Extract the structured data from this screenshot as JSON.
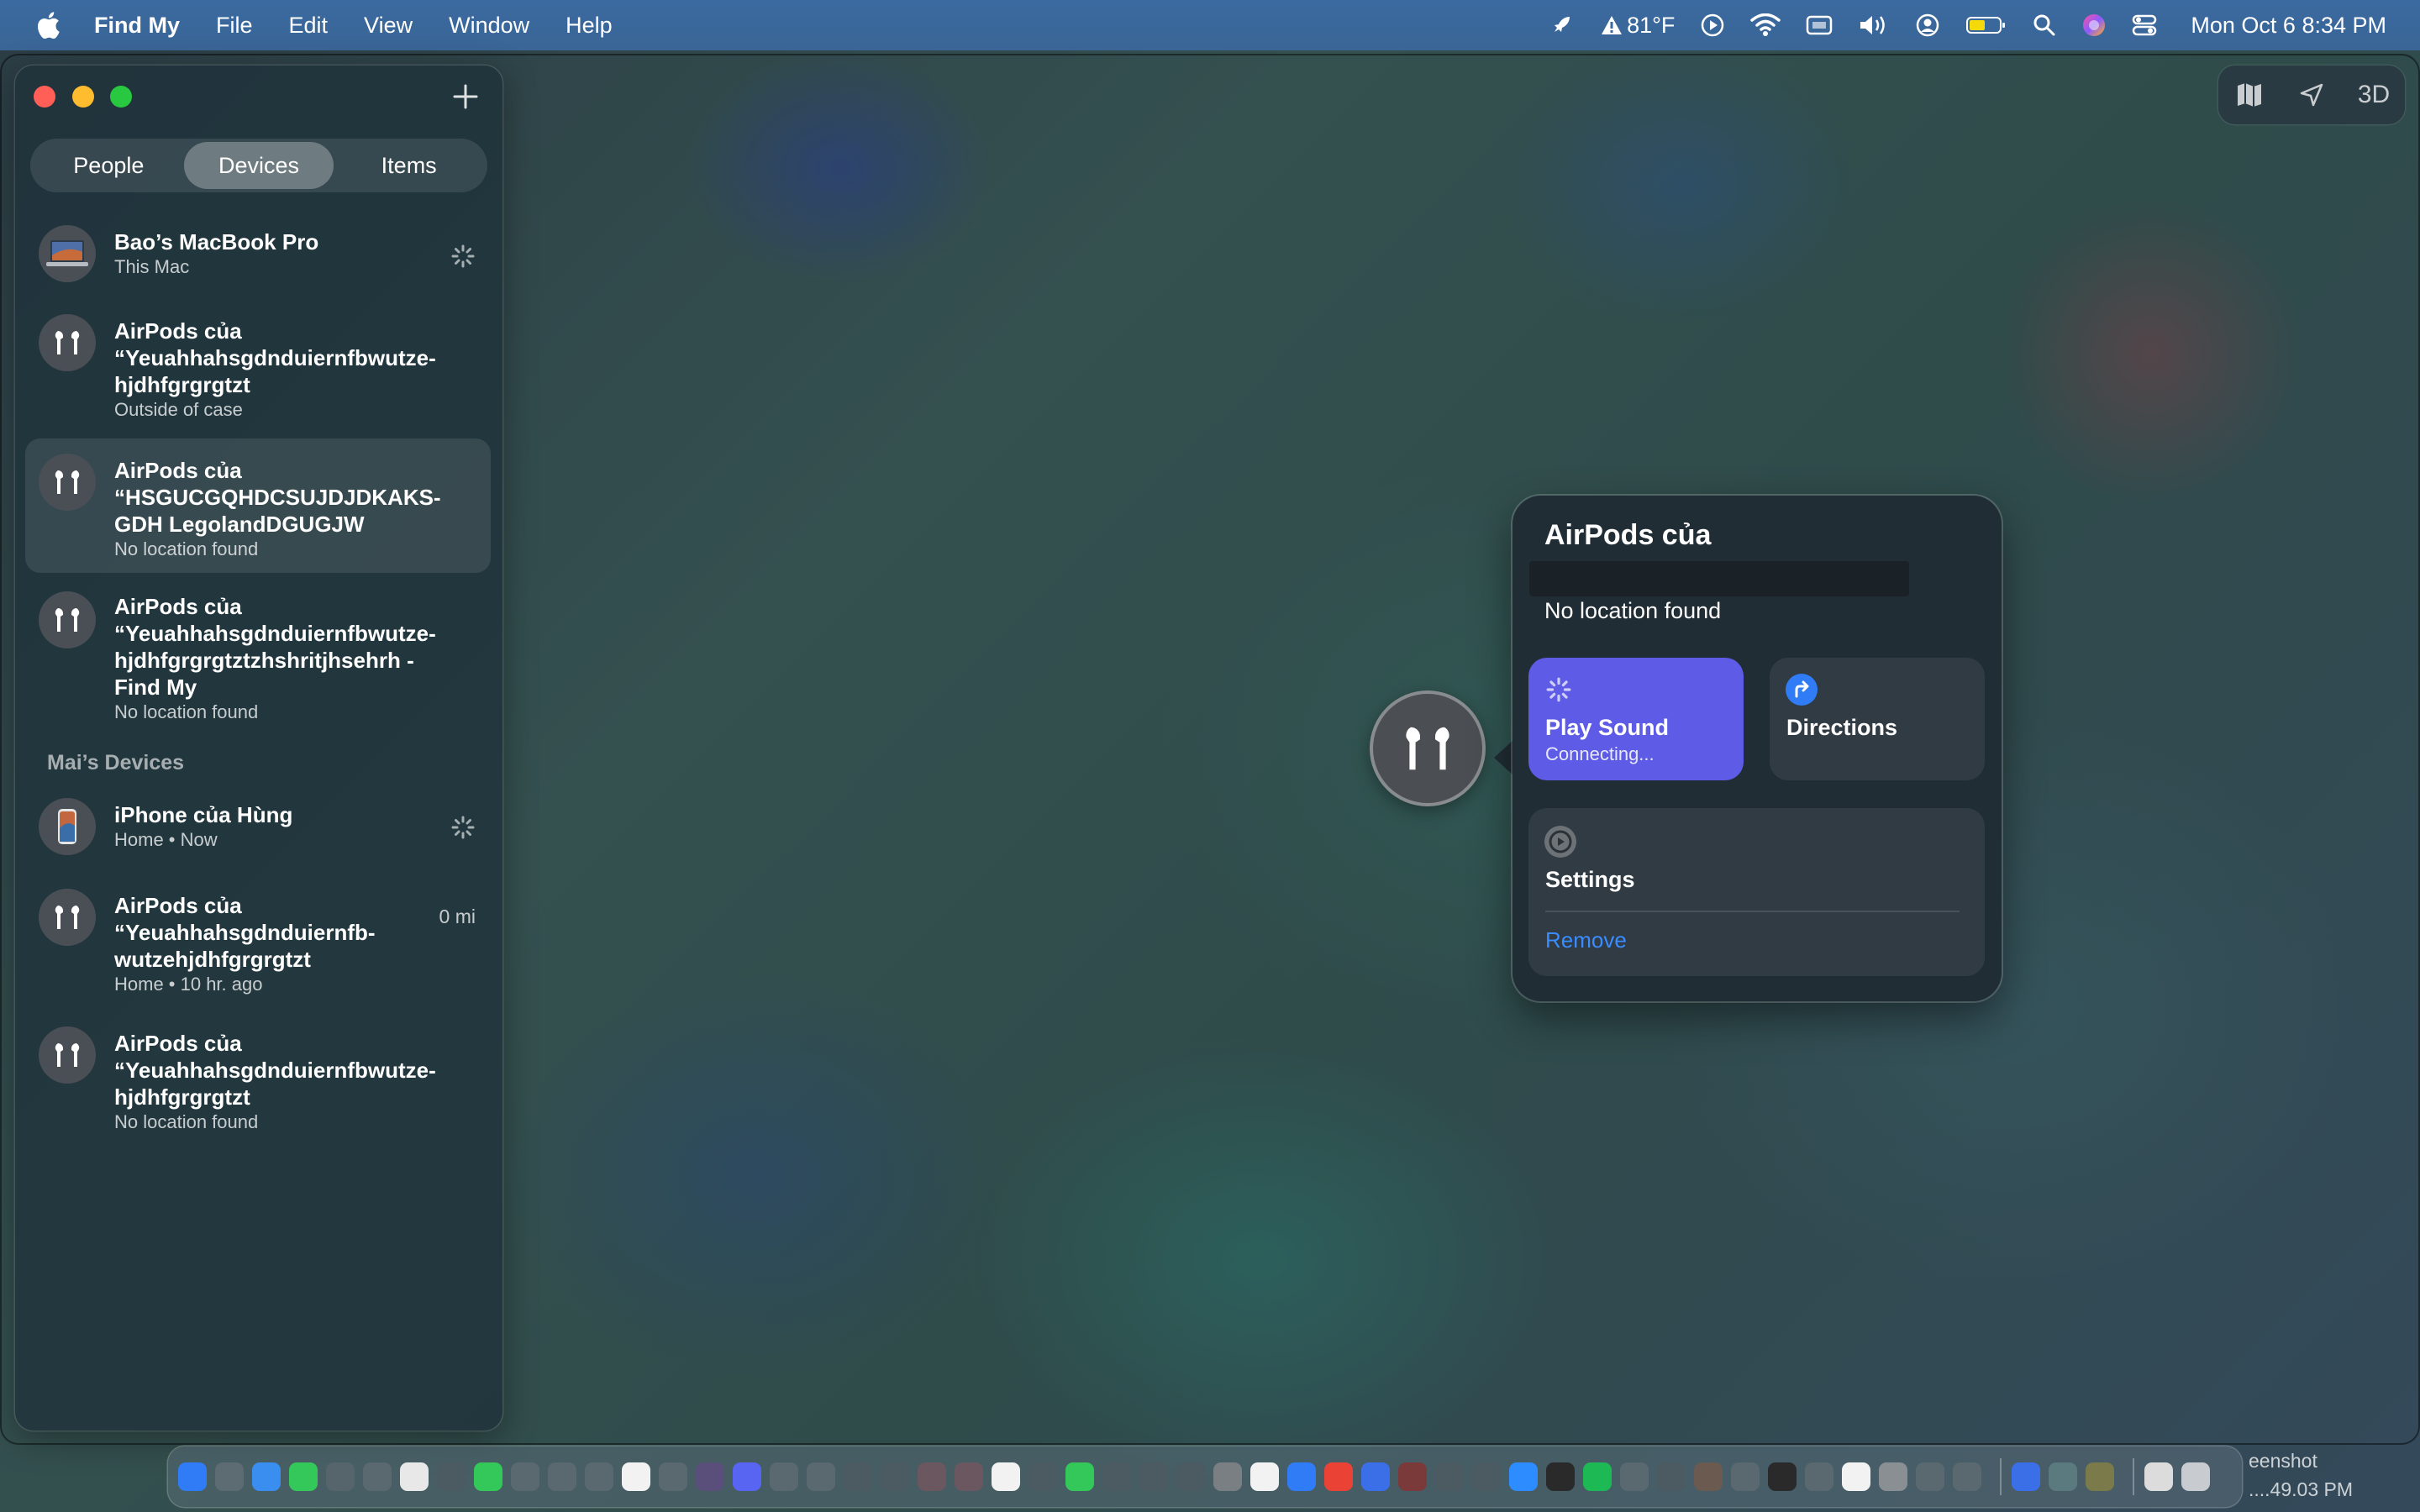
{
  "menubar": {
    "app_name": "Find My",
    "menus": [
      "File",
      "Edit",
      "View",
      "Window",
      "Help"
    ],
    "weather": "81°F",
    "clock": "Mon Oct 6  8:34 PM"
  },
  "sidebar": {
    "tabs": [
      "People",
      "Devices",
      "Items"
    ],
    "active_tab": "Devices",
    "devices": [
      {
        "name_lines": [
          "Bao’s MacBook Pro"
        ],
        "subtitle": "This Mac",
        "icon": "laptop-icon",
        "meta": ""
      },
      {
        "name_lines": [
          "AirPods của",
          "“Yeuahhahsgdnduiernfbwutze-",
          "hjdhfgrgrgtzt"
        ],
        "subtitle": "Outside of case",
        "icon": "airpods-icon",
        "meta": ""
      },
      {
        "name_lines": [
          "AirPods của",
          "“HSGUCGQHDCSUJDJDKAKS-",
          "GDH LegolandDGUGJW"
        ],
        "subtitle": "No location found",
        "icon": "airpods-icon",
        "meta": ""
      },
      {
        "name_lines": [
          "AirPods của",
          "“Yeuahhahsgdnduiernfbwutze-",
          "hjdhfgrgrgtztzhshritjhsehrh -",
          "Find My"
        ],
        "subtitle": "No location found",
        "icon": "airpods-icon",
        "meta": ""
      }
    ],
    "section_header": "Mai’s Devices",
    "mai_devices": [
      {
        "name_lines": [
          "iPhone của Hùng"
        ],
        "subtitle": "Home • Now",
        "icon": "iphone-icon",
        "meta": ""
      },
      {
        "name_lines": [
          "AirPods của",
          "“Yeuahhahsgdnduiernfb-",
          "wutzehjdhfgrgrgtzt"
        ],
        "subtitle": "Home • 10 hr. ago",
        "icon": "airpods-icon",
        "meta": "0 mi"
      },
      {
        "name_lines": [
          "AirPods của",
          "“Yeuahhahsgdnduiernfbwutze-",
          "hjdhfgrgrgtzt"
        ],
        "subtitle": "No location found",
        "icon": "airpods-icon",
        "meta": ""
      }
    ]
  },
  "map_controls": {
    "three_d": "3D"
  },
  "popover": {
    "title": "AirPods của",
    "status": "No location found",
    "play_sound": {
      "title": "Play Sound",
      "subtitle": "Connecting..."
    },
    "directions": {
      "title": "Directions"
    },
    "settings": {
      "title": "Settings",
      "remove": "Remove"
    }
  },
  "desktop": {
    "screenshot_label_1": "eenshot",
    "screenshot_label_2": "....49.03 PM"
  },
  "colors": {
    "accent_purple": "#5e5ce6",
    "link_blue": "#3b8cff",
    "menubar": "#3b6aa0"
  }
}
